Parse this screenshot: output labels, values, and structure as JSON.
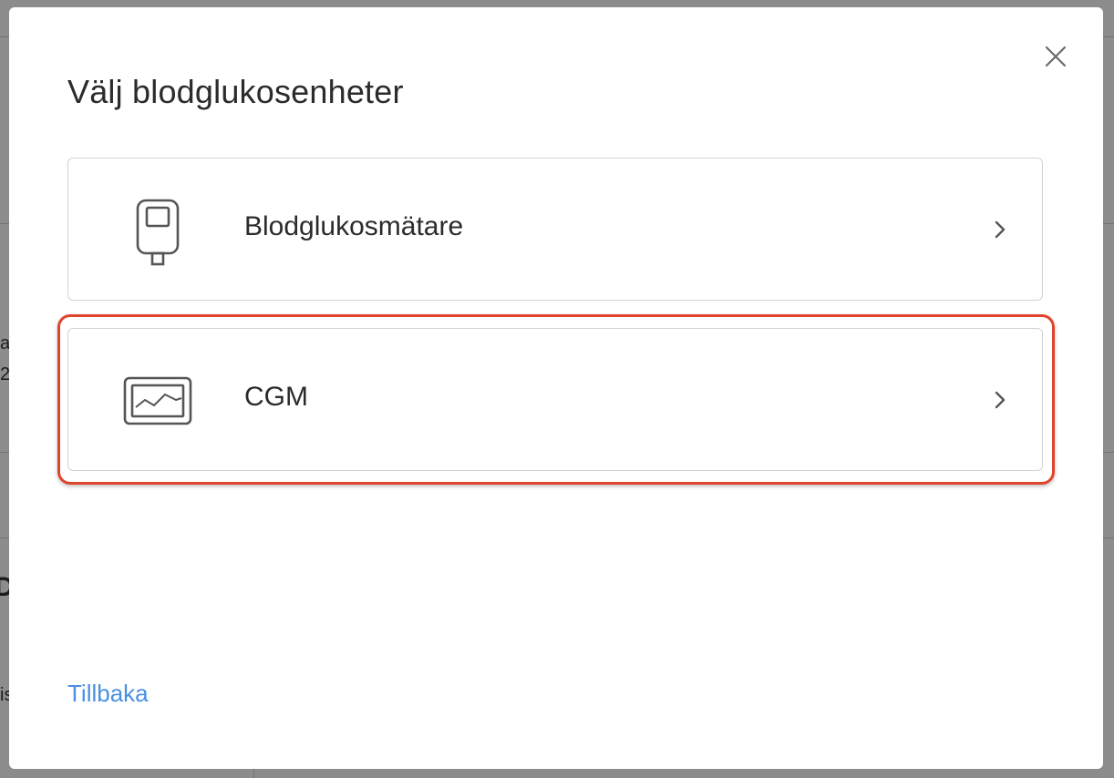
{
  "background": {
    "fragments": [
      "a",
      "2",
      "D",
      "is"
    ]
  },
  "modal": {
    "title": "Välj blodglukosenheter",
    "close_icon": "close-icon",
    "options": [
      {
        "label": "Blodglukosmätare",
        "icon": "glucose-meter-icon"
      },
      {
        "label": "CGM",
        "icon": "cgm-monitor-icon"
      }
    ],
    "highlighted_option": "CGM",
    "back_label": "Tillbaka"
  },
  "colors": {
    "link": "#4a90e2",
    "highlight": "#e0442c",
    "card_border": "#cfd3d8"
  }
}
